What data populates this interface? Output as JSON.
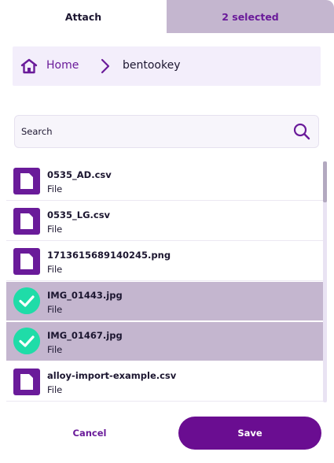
{
  "tabs": {
    "attach": "Attach",
    "selected": "2 selected"
  },
  "breadcrumb": {
    "home": "Home",
    "current": "bentookey"
  },
  "search": {
    "placeholder": "Search"
  },
  "files": [
    {
      "name": "0535_AD.csv",
      "type": "File",
      "selected": false
    },
    {
      "name": "0535_LG.csv",
      "type": "File",
      "selected": false
    },
    {
      "name": "1713615689140245.png",
      "type": "File",
      "selected": false
    },
    {
      "name": "IMG_01443.jpg",
      "type": "File",
      "selected": true
    },
    {
      "name": "IMG_01467.jpg",
      "type": "File",
      "selected": true
    },
    {
      "name": "alloy-import-example.csv",
      "type": "File",
      "selected": false
    }
  ],
  "actions": {
    "cancel": "Cancel",
    "save": "Save"
  },
  "colors": {
    "accent": "#6a1b9a",
    "selected_row": "#c4b6cf",
    "check": "#1fdca8",
    "breadcrumb_bg": "#f3eefb"
  },
  "icons": {
    "home": "home-icon",
    "separator": "chevron-right-icon",
    "search": "search-icon",
    "file": "file-icon",
    "check": "check-circle-icon"
  }
}
